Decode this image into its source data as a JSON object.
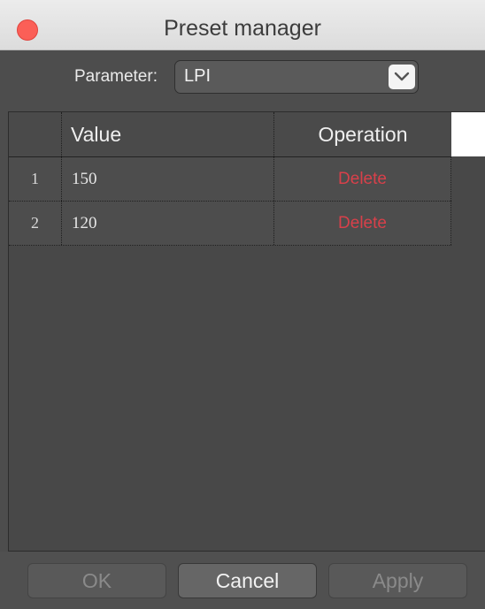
{
  "window": {
    "title": "Preset manager"
  },
  "parameter": {
    "label": "Parameter:",
    "selected": "LPI"
  },
  "table": {
    "columns": [
      "",
      "Value",
      "Operation"
    ],
    "rows": [
      {
        "index": "1",
        "value": "150",
        "operation": "Delete"
      },
      {
        "index": "2",
        "value": "120",
        "operation": "Delete"
      }
    ]
  },
  "buttons": {
    "ok": "OK",
    "cancel": "Cancel",
    "apply": "Apply"
  },
  "colors": {
    "window_bg": "#4d4d4d",
    "delete_text": "#d8404a",
    "close_button": "#fb5f57"
  }
}
